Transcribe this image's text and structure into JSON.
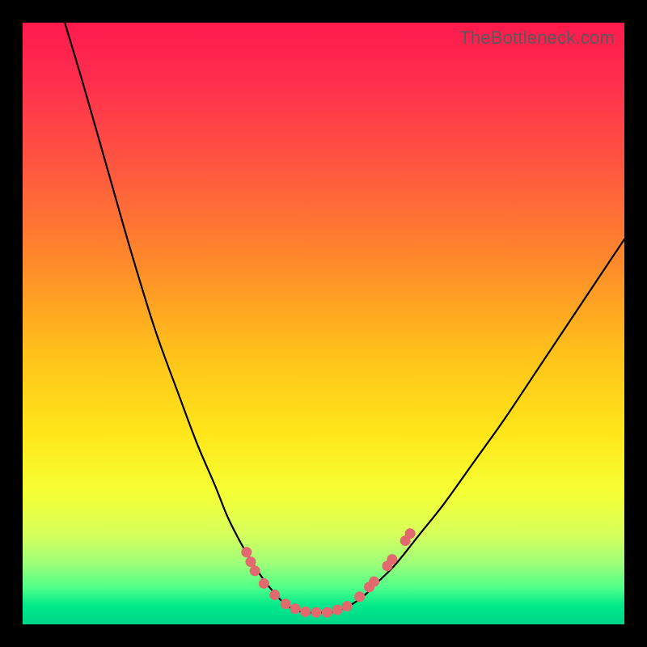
{
  "watermark": "TheBottleneck.com",
  "colors": {
    "frame": "#000000",
    "watermark_text": "#595959",
    "curve": "#000000",
    "marker": "#e06a6e",
    "gradient_stops": [
      "#ff1a4d",
      "#ff5a3f",
      "#ffc21a",
      "#f5ff33",
      "#4cff8a",
      "#00d48a"
    ]
  },
  "chart_data": {
    "type": "line",
    "title": "",
    "xlabel": "",
    "ylabel": "",
    "xlim": [
      0,
      100
    ],
    "ylim": [
      0,
      100
    ],
    "grid": false,
    "legend": null,
    "series": [
      {
        "name": "left-curve",
        "x": [
          7,
          10,
          14,
          18,
          22,
          26,
          29,
          32,
          34,
          36,
          38,
          40,
          42,
          43.5,
          45
        ],
        "y": [
          100,
          90,
          76,
          62,
          49,
          38,
          30,
          23,
          18,
          14,
          10.5,
          7.5,
          5,
          3.5,
          2.5
        ]
      },
      {
        "name": "valley-flat",
        "x": [
          45,
          47,
          49,
          51,
          53
        ],
        "y": [
          2.5,
          2,
          2,
          2,
          2.5
        ]
      },
      {
        "name": "right-curve",
        "x": [
          53,
          55,
          57,
          59,
          62,
          66,
          70,
          75,
          80,
          86,
          92,
          98,
          100
        ],
        "y": [
          2.5,
          3.5,
          5,
          7,
          10,
          15,
          20,
          27,
          34,
          43,
          52,
          61,
          64
        ]
      }
    ],
    "markers": [
      {
        "x": 37.2,
        "y": 12.0
      },
      {
        "x": 37.9,
        "y": 10.4
      },
      {
        "x": 38.6,
        "y": 8.9
      },
      {
        "x": 40.1,
        "y": 6.8
      },
      {
        "x": 41.9,
        "y": 4.9
      },
      {
        "x": 43.7,
        "y": 3.4
      },
      {
        "x": 45.3,
        "y": 2.6
      },
      {
        "x": 47.0,
        "y": 2.1
      },
      {
        "x": 48.8,
        "y": 2.0
      },
      {
        "x": 50.6,
        "y": 2.0
      },
      {
        "x": 52.3,
        "y": 2.4
      },
      {
        "x": 53.9,
        "y": 3.0
      },
      {
        "x": 56.0,
        "y": 4.6
      },
      {
        "x": 57.6,
        "y": 6.2
      },
      {
        "x": 58.4,
        "y": 7.1
      },
      {
        "x": 60.6,
        "y": 9.7
      },
      {
        "x": 61.4,
        "y": 10.8
      },
      {
        "x": 63.6,
        "y": 13.9
      },
      {
        "x": 64.4,
        "y": 15.1
      }
    ]
  }
}
